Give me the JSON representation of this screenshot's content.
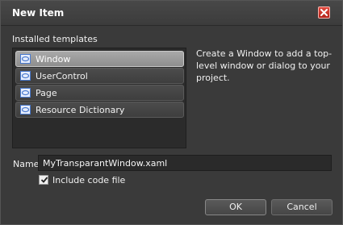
{
  "window": {
    "title": "New Item",
    "close_icon": "close-icon"
  },
  "templates": {
    "heading": "Installed templates",
    "items": [
      {
        "label": "Window",
        "selected": true,
        "icon": "xaml-icon"
      },
      {
        "label": "UserControl",
        "selected": false,
        "icon": "xaml-icon"
      },
      {
        "label": "Page",
        "selected": false,
        "icon": "xaml-icon"
      },
      {
        "label": "Resource Dictionary",
        "selected": false,
        "icon": "xaml-icon"
      }
    ]
  },
  "description": "Create a Window to add a top-level window or dialog to your project.",
  "name_field": {
    "label": "Name",
    "value": "MyTransparantWindow.xaml"
  },
  "include_code": {
    "label": "Include code file",
    "checked": true
  },
  "buttons": {
    "ok": "OK",
    "cancel": "Cancel"
  },
  "colors": {
    "close_red": "#c9302c",
    "icon_blue": "#4a7bd1"
  }
}
